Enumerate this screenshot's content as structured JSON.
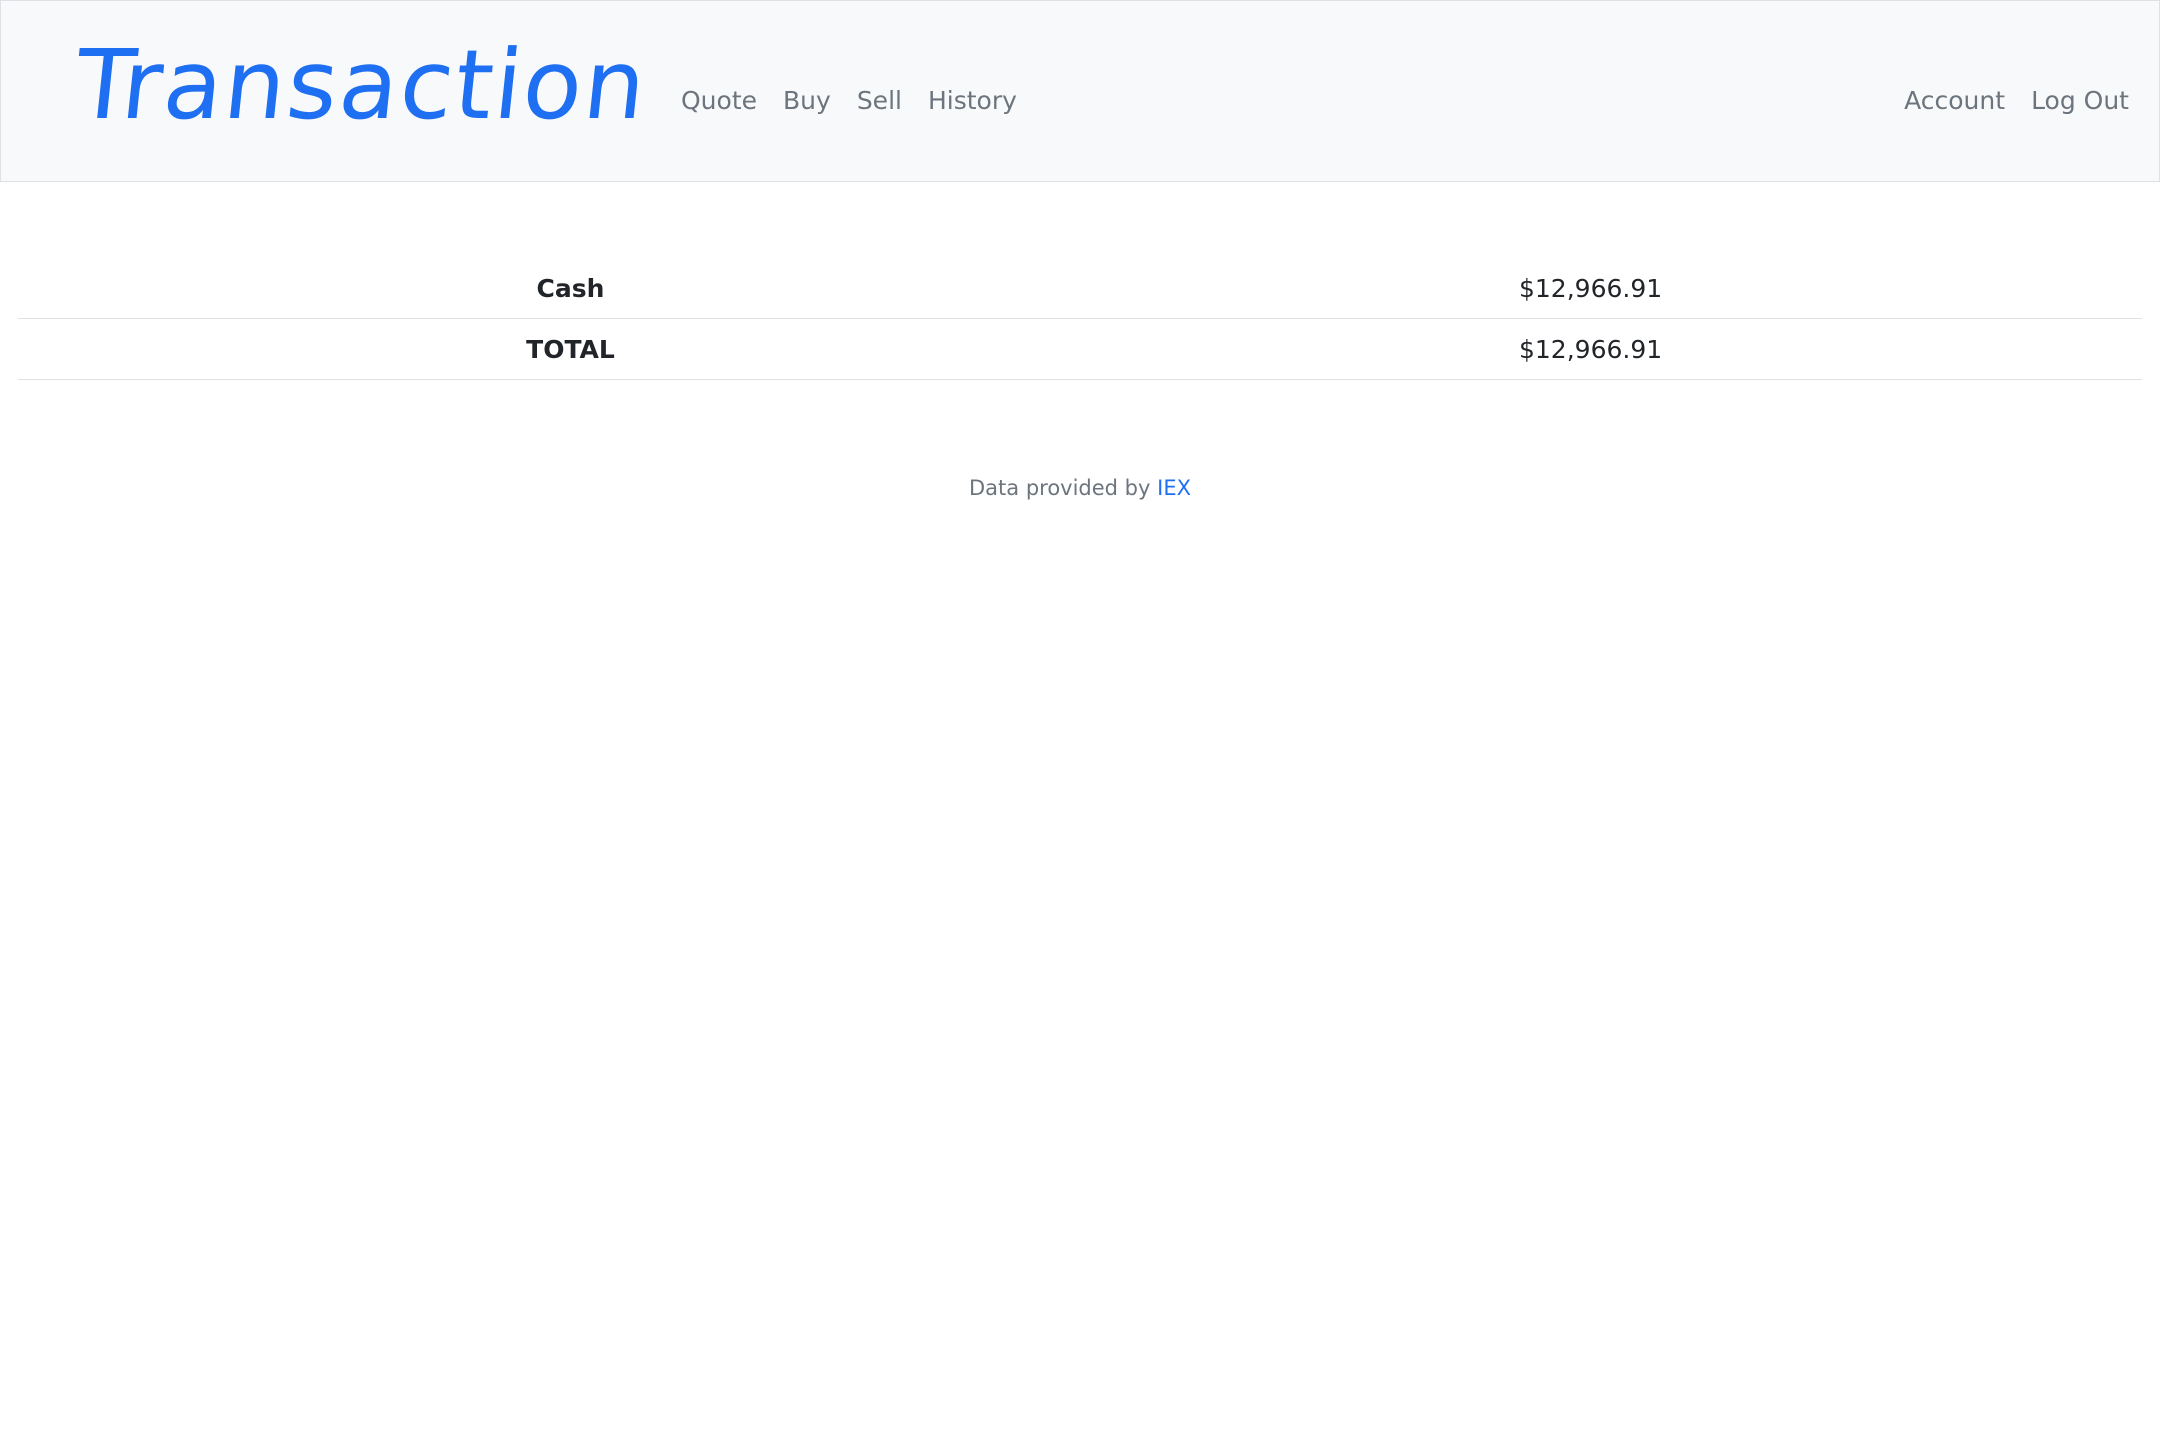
{
  "header": {
    "brand": "Transaction",
    "nav_left": [
      "Quote",
      "Buy",
      "Sell",
      "History"
    ],
    "nav_right": [
      "Account",
      "Log Out"
    ]
  },
  "summary": {
    "rows": [
      {
        "label": "Cash",
        "value": "$12,966.91"
      },
      {
        "label": "TOTAL",
        "value": "$12,966.91"
      }
    ]
  },
  "footer": {
    "prefix": "Data provided by",
    "link": "IEX"
  },
  "colors": {
    "brand": "#1f6ff2",
    "nav_bg": "#f8f9fa",
    "nav_text": "#6c757d",
    "border": "#dee2e6"
  }
}
